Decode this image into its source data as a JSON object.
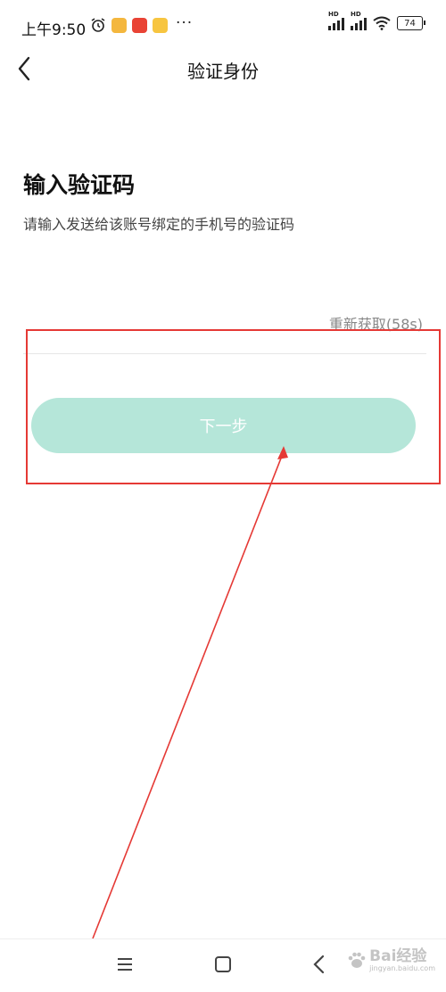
{
  "status_bar": {
    "time": "上午9:50",
    "battery": "74",
    "more": "···",
    "hd_label": "HD"
  },
  "nav": {
    "title": "验证身份"
  },
  "content": {
    "heading": "输入验证码",
    "subtext": "请输入发送给该账号绑定的手机号的验证码",
    "resend_label": "重新获取(58s)",
    "code_value": "",
    "next_button": "下一步"
  },
  "watermark": {
    "text": "Bai经验",
    "sub": "jingyan.baidu.com"
  },
  "colors": {
    "button_bg": "#b5e6d9",
    "highlight": "#e53935"
  }
}
